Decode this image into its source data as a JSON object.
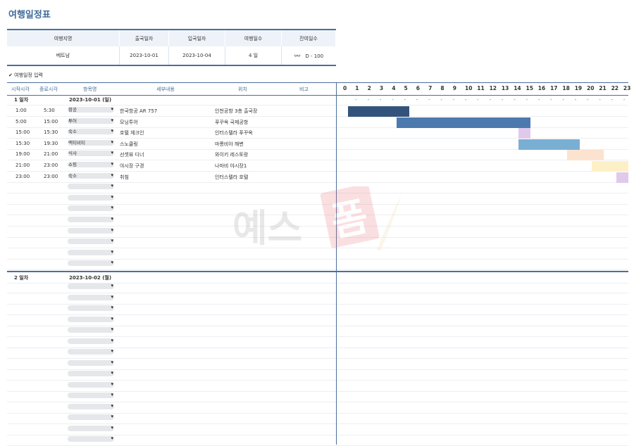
{
  "app_title": "여행일정표",
  "summary": {
    "headers": [
      "여행지명",
      "출국일자",
      "입국일자",
      "여행일수",
      "잔여일수"
    ],
    "values": [
      "베트남",
      "2023-10-01",
      "2023-10-04",
      "4 일",
      "D - 100"
    ]
  },
  "section_title": "✔ 여행일정 입력",
  "columns": [
    "시작시각",
    "종료시각",
    "항목명",
    "세부내용",
    "위치",
    "비고"
  ],
  "hours": [
    "0",
    "1",
    "2",
    "3",
    "4",
    "5",
    "6",
    "7",
    "8",
    "9",
    "10",
    "11",
    "12",
    "13",
    "14",
    "15",
    "16",
    "17",
    "18",
    "19",
    "20",
    "21",
    "22",
    "23"
  ],
  "day1": {
    "label": "1 일차",
    "date": "2023-10-01 (일)",
    "items": [
      {
        "start": "1:00",
        "end": "5:30",
        "category": "항공",
        "detail": "한국항공 AR 757",
        "location": "인천공항 3층 출국장"
      },
      {
        "start": "5:00",
        "end": "15:00",
        "category": "투어",
        "detail": "모닝투어",
        "location": "푸꾸옥 국제공항"
      },
      {
        "start": "15:00",
        "end": "15:30",
        "category": "숙소",
        "detail": "호텔 체크인",
        "location": "인터스텔라 푸꾸옥"
      },
      {
        "start": "15:30",
        "end": "19:30",
        "category": "액티비티",
        "detail": "스노쿨링",
        "location": "마롱비아 해변"
      },
      {
        "start": "19:00",
        "end": "21:00",
        "category": "식사",
        "detail": "선셋뷰 디너",
        "location": "와이키 레스토랑"
      },
      {
        "start": "21:00",
        "end": "23:00",
        "category": "쇼핑",
        "detail": "야시장 구경",
        "location": "나마비 야시장1"
      },
      {
        "start": "23:00",
        "end": "23:00",
        "category": "숙소",
        "detail": "취침",
        "location": "인터스텔라 호텔"
      }
    ]
  },
  "day2": {
    "label": "2 일차",
    "date": "2023-10-02 (월)"
  },
  "gantt": [
    {
      "start": 1.0,
      "end": 6.0,
      "color": "#34537a"
    },
    {
      "start": 5.0,
      "end": 16.0,
      "color": "#4c7aae"
    },
    {
      "start": 15.0,
      "end": 16.0,
      "color": "#e1c9ec"
    },
    {
      "start": 15.0,
      "end": 20.0,
      "color": "#7aafd4"
    },
    {
      "start": 19.0,
      "end": 22.0,
      "color": "#fbe3cf"
    },
    {
      "start": 21.0,
      "end": 24.0,
      "color": "#fef0c6"
    },
    {
      "start": 23.0,
      "end": 24.0,
      "color": "#e1c9ec"
    }
  ],
  "watermark": "예스폼",
  "icons": {
    "remain": "glasses-icon"
  }
}
